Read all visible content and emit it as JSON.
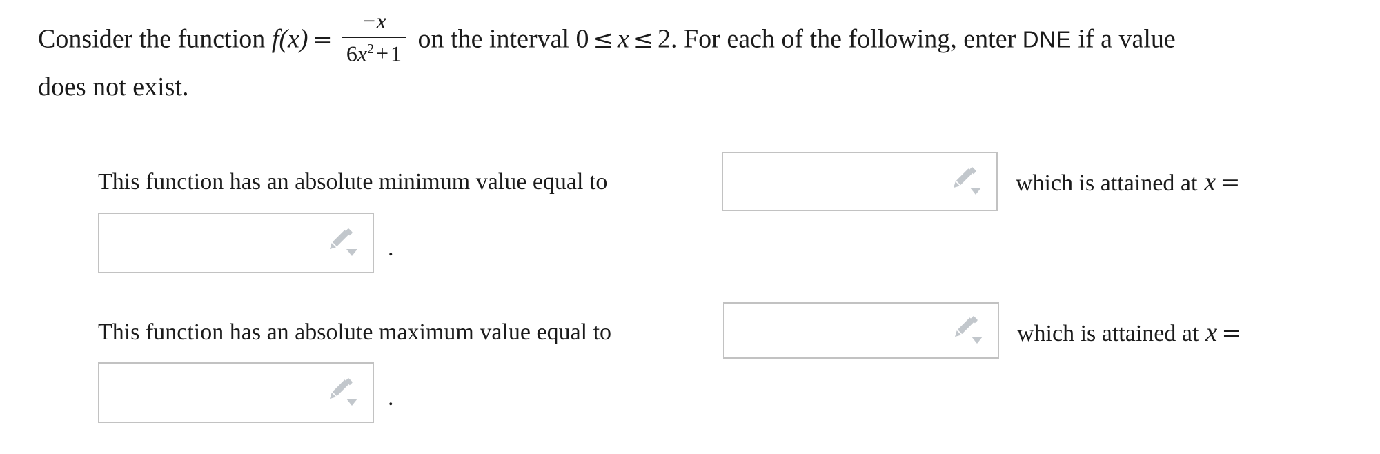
{
  "problem": {
    "intro_before_formula": "Consider the function ",
    "function_name": "f",
    "function_arg": "(x)",
    "equals": "=",
    "formula": {
      "numerator": "−x",
      "denominator_coefficient": "6",
      "denominator_variable": "x",
      "denominator_exponent": "2",
      "denominator_operator": "+",
      "denominator_constant": "1",
      "latex": "f(x) = \\frac{-x}{6x^2+1}"
    },
    "interval_text_before": " on the interval ",
    "interval": {
      "lower": "0",
      "lower_relation": "≤",
      "variable": "x",
      "upper_relation": "≤",
      "upper": "2"
    },
    "instruction_before_dne": ". For each of the following, enter ",
    "dne_token": "DNE",
    "instruction_after_dne": " if a value",
    "line2": "does not exist."
  },
  "questions": [
    {
      "id": "absolute-minimum",
      "prompt": "This function has an absolute minimum value equal to",
      "value_input": {
        "value": "",
        "placeholder": "",
        "icon": "pencil-dropdown-icon"
      },
      "connector": "which is attained at",
      "connector_variable": "x",
      "connector_equals": "=",
      "location_input": {
        "value": "",
        "placeholder": "",
        "icon": "pencil-dropdown-icon"
      },
      "trailing_punctuation": "."
    },
    {
      "id": "absolute-maximum",
      "prompt": "This function has an absolute maximum value equal to",
      "value_input": {
        "value": "",
        "placeholder": "",
        "icon": "pencil-dropdown-icon"
      },
      "connector": "which is attained at",
      "connector_variable": "x",
      "connector_equals": "=",
      "location_input": {
        "value": "",
        "placeholder": "",
        "icon": "pencil-dropdown-icon"
      },
      "trailing_punctuation": "."
    }
  ],
  "colors": {
    "text": "#1b1b1b",
    "input_border": "#c2c2c2",
    "input_background": "#ffffff",
    "icon": "#c2c7cc",
    "page_background": "#ffffff"
  }
}
